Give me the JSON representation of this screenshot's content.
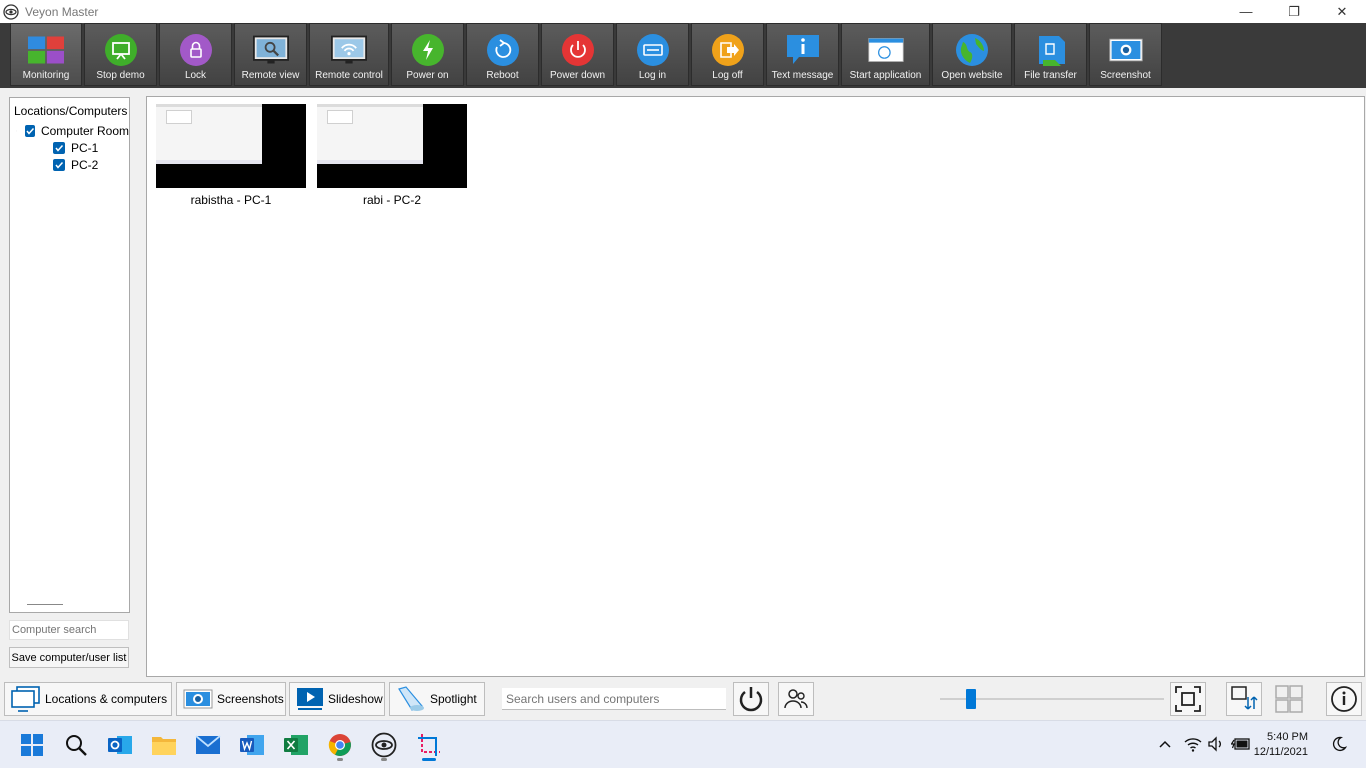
{
  "window": {
    "title": "Veyon Master",
    "controls": {
      "minimize": "—",
      "restore": "❐",
      "close": "✕"
    }
  },
  "toolbar": {
    "buttons": [
      {
        "label": "Monitoring",
        "icon": "monitoring-icon",
        "active": true
      },
      {
        "label": "Stop demo",
        "icon": "demo-icon",
        "color": "#3fae2a"
      },
      {
        "label": "Lock",
        "icon": "lock-icon",
        "color": "#a259c8"
      },
      {
        "label": "Remote view",
        "icon": "remote-view-icon"
      },
      {
        "label": "Remote control",
        "icon": "remote-control-icon"
      },
      {
        "label": "Power on",
        "icon": "power-on-icon",
        "color": "#47b52d"
      },
      {
        "label": "Reboot",
        "icon": "reboot-icon",
        "color": "#2b8fe0"
      },
      {
        "label": "Power down",
        "icon": "power-down-icon",
        "color": "#e53535"
      },
      {
        "label": "Log in",
        "icon": "log-in-icon",
        "color": "#2b8fe0"
      },
      {
        "label": "Log off",
        "icon": "log-off-icon",
        "color": "#f0a21a"
      },
      {
        "label": "Text message",
        "icon": "text-message-icon",
        "color": "#2b8fe0"
      },
      {
        "label": "Start application",
        "icon": "start-application-icon"
      },
      {
        "label": "Open website",
        "icon": "open-website-icon"
      },
      {
        "label": "File transfer",
        "icon": "file-transfer-icon"
      },
      {
        "label": "Screenshot",
        "icon": "screenshot-icon"
      }
    ]
  },
  "left_panel": {
    "header": "Locations/Computers",
    "tree": {
      "location": {
        "label": "Computer Room",
        "checked": true,
        "expanded": true
      },
      "computers": [
        {
          "label": "PC-1",
          "checked": true
        },
        {
          "label": "PC-2",
          "checked": true
        }
      ]
    },
    "search_placeholder": "Computer search",
    "save_button": "Save computer/user list"
  },
  "main": {
    "computers": [
      {
        "caption": "rabistha - PC-1"
      },
      {
        "caption": "rabi - PC-2"
      }
    ]
  },
  "bottom_bar": {
    "locations_button": "Locations & computers",
    "screenshots_button": "Screenshots",
    "slideshow_button": "Slideshow",
    "spotlight_button": "Spotlight",
    "search_placeholder": "Search users and computers",
    "zoom_level": 0.12
  },
  "taskbar": {
    "apps": [
      "start-icon",
      "search-icon",
      "outlook-icon",
      "file-explorer-icon",
      "mail-icon",
      "word-icon",
      "excel-icon",
      "chrome-icon",
      "veyon-icon",
      "snipping-tool-icon"
    ],
    "time": "5:40 PM",
    "date": "12/11/2021"
  },
  "colors": {
    "toolbar_bg": "#3a3a3a",
    "accent": "#0078d7",
    "checkbox": "#0063b1"
  }
}
